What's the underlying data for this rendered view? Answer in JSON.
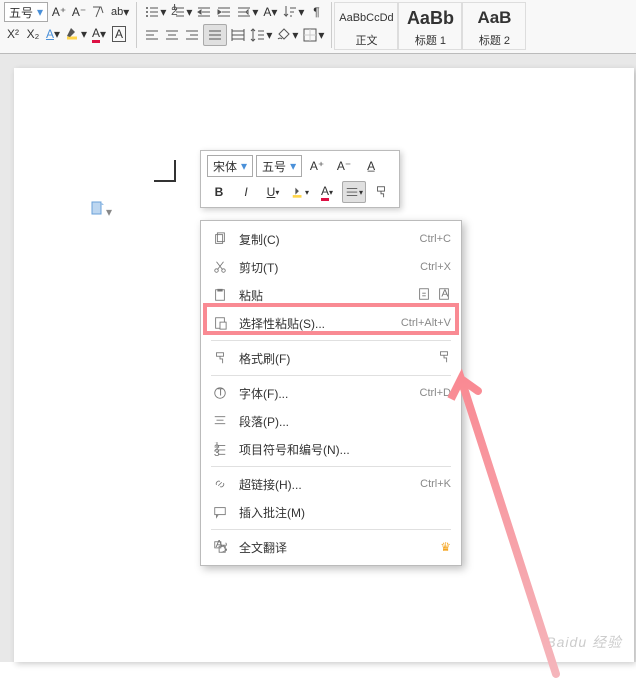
{
  "ribbon": {
    "fontSize": "五号",
    "styles": [
      {
        "preview": "AaBbCcDd",
        "name": "正文",
        "weight": "normal",
        "size": "11px"
      },
      {
        "preview": "AaBb",
        "name": "标题 1",
        "weight": "bold",
        "size": "18px"
      },
      {
        "preview": "AaB",
        "name": "标题 2",
        "weight": "bold",
        "size": "17px"
      }
    ]
  },
  "floatbar": {
    "font": "宋体",
    "size": "五号"
  },
  "ctx": [
    {
      "icon": "copy",
      "label": "复制(C)",
      "shortcut": "Ctrl+C"
    },
    {
      "icon": "cut",
      "label": "剪切(T)",
      "shortcut": "Ctrl+X"
    },
    {
      "icon": "clipboard",
      "label": "粘贴",
      "right": [
        "clip-plain",
        "clip-match"
      ]
    },
    {
      "icon": "paste-special",
      "label": "选择性粘贴(S)...",
      "shortcut": "Ctrl+Alt+V"
    },
    {
      "sep": true
    },
    {
      "icon": "format-painter",
      "label": "格式刷(F)",
      "right": [
        "format-painter"
      ]
    },
    {
      "sep": true
    },
    {
      "icon": "font-t",
      "label": "字体(F)...",
      "shortcut": "Ctrl+D"
    },
    {
      "icon": "paragraph",
      "label": "段落(P)..."
    },
    {
      "icon": "list",
      "label": "项目符号和编号(N)..."
    },
    {
      "sep": true
    },
    {
      "icon": "link",
      "label": "超链接(H)...",
      "shortcut": "Ctrl+K"
    },
    {
      "icon": "comment",
      "label": "插入批注(M)"
    },
    {
      "sep": true
    },
    {
      "icon": "translate",
      "label": "全文翻译",
      "crown": true
    }
  ],
  "watermark": "Baidu 经验"
}
